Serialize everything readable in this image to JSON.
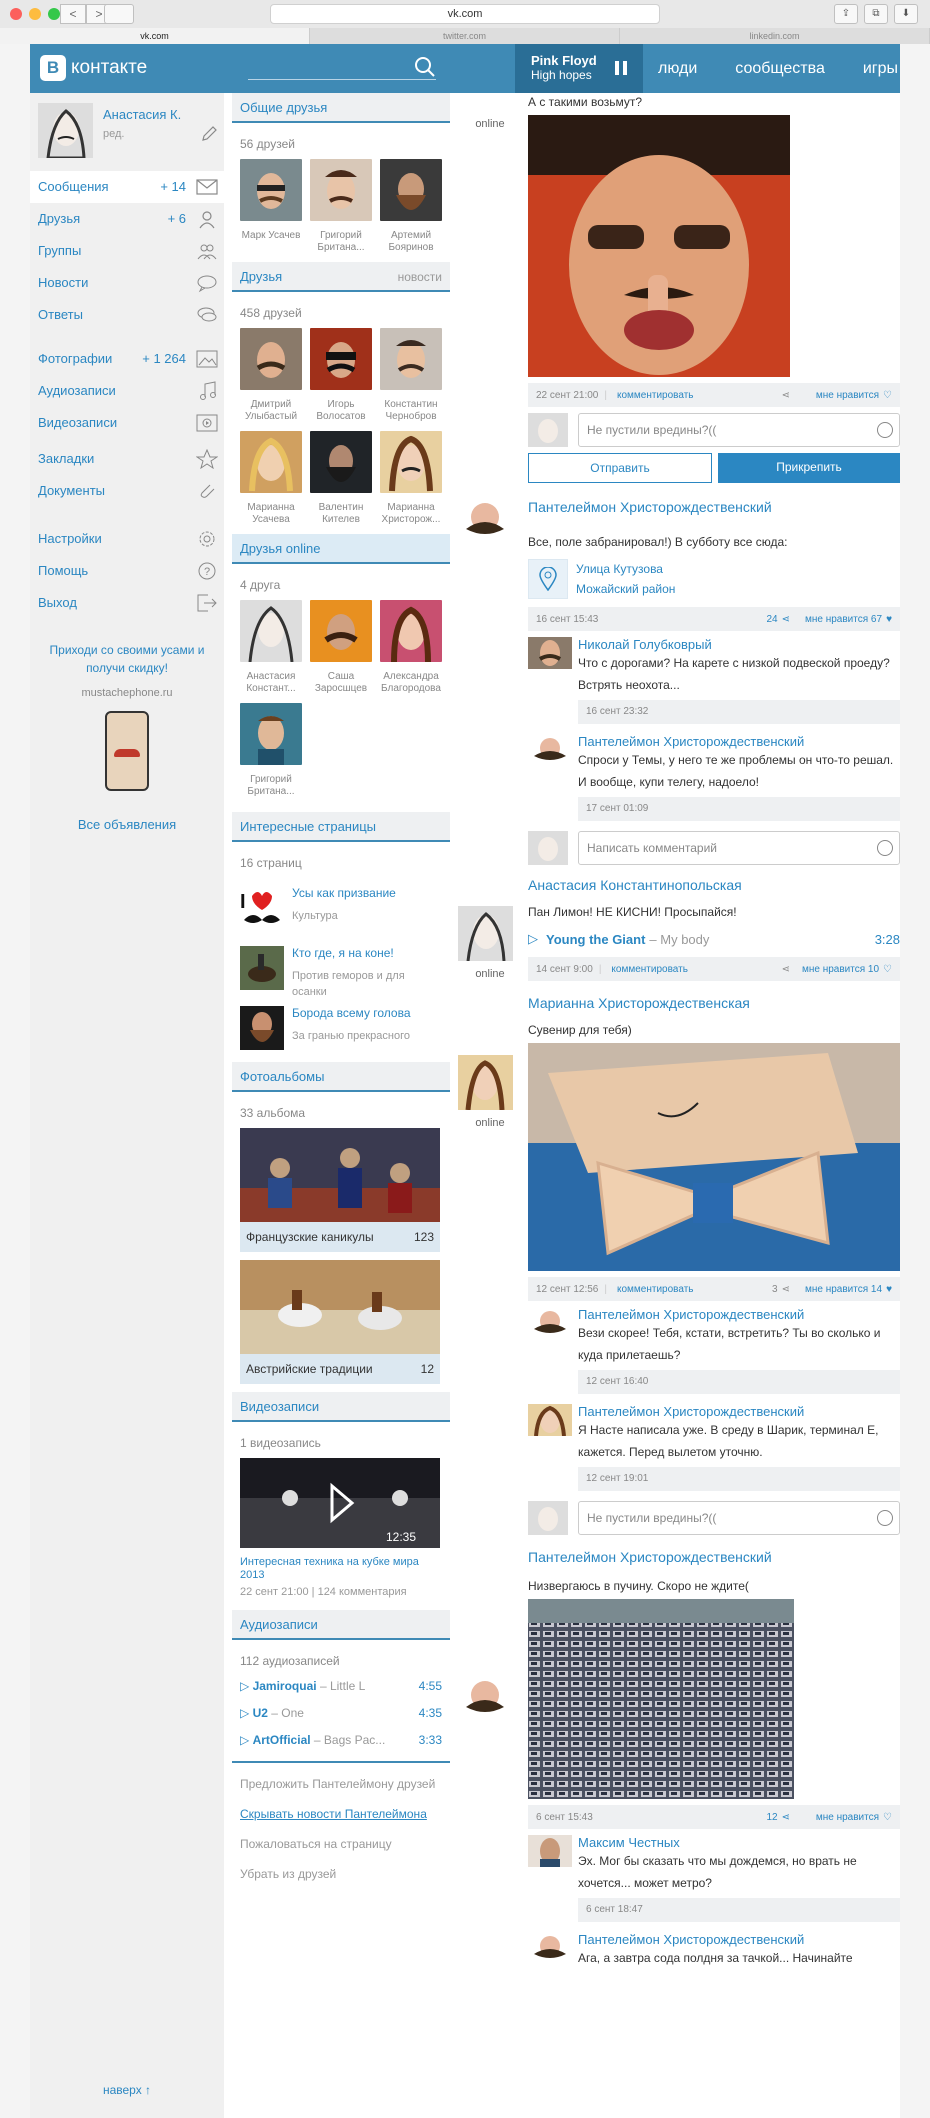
{
  "browser": {
    "url": "vk.com",
    "tabs": [
      "vk.com",
      "twitter.com",
      "linkedin.com"
    ],
    "back": "<",
    "forward": ">"
  },
  "header": {
    "logo_letter": "В",
    "logo_text": "контакте",
    "player_title": "Pink Floyd",
    "player_sub": "High hopes",
    "nav": [
      "люди",
      "сообщества",
      "игры"
    ]
  },
  "profile": {
    "name": "Анастасия К.",
    "edit": "ред."
  },
  "menu": [
    {
      "label": "Сообщения",
      "count": "+ 14",
      "icon": "envelope-icon"
    },
    {
      "label": "Друзья",
      "count": "+ 6",
      "icon": "person-icon"
    },
    {
      "label": "Группы",
      "count": "",
      "icon": "group-icon"
    },
    {
      "label": "Новости",
      "count": "",
      "icon": "speech-bubble-icon"
    },
    {
      "label": "Ответы",
      "count": "",
      "icon": "chat-bubbles-icon"
    }
  ],
  "menu2": [
    {
      "label": "Фотографии",
      "count": "+ 1 264",
      "icon": "photo-icon"
    },
    {
      "label": "Аудиозаписи",
      "count": "",
      "icon": "music-note-icon"
    },
    {
      "label": "Видеозаписи",
      "count": "",
      "icon": "video-icon"
    }
  ],
  "menu3": [
    {
      "label": "Закладки",
      "icon": "star-icon"
    },
    {
      "label": "Документы",
      "icon": "paperclip-icon"
    }
  ],
  "menu4": [
    {
      "label": "Настройки",
      "icon": "gear-icon"
    },
    {
      "label": "Помощь",
      "icon": "question-icon"
    },
    {
      "label": "Выход",
      "icon": "exit-icon"
    }
  ],
  "ad": {
    "text": "Приходи со своими усами и получи скидку!",
    "url": "mustachephone.ru",
    "all": "Все объявления"
  },
  "up": "наверх ↑",
  "common_friends": {
    "title": "Общие друзья",
    "count": "56 друзей",
    "items": [
      {
        "name": "Марк Усачев"
      },
      {
        "name": "Григорий Британа..."
      },
      {
        "name": "Артемий Бояринов"
      }
    ]
  },
  "friends": {
    "title": "Друзья",
    "right": "новости",
    "count": "458 друзей",
    "items": [
      {
        "name": "Дмитрий Улыбастый"
      },
      {
        "name": "Игорь Волосатов"
      },
      {
        "name": "Константин Чернобров"
      },
      {
        "name": "Марианна Усачева"
      },
      {
        "name": "Валентин Кителев"
      },
      {
        "name": "Марианна Христорож..."
      }
    ]
  },
  "friends_online": {
    "title": "Друзья online",
    "count": "4 друга",
    "items": [
      {
        "name": "Анастасия Констант..."
      },
      {
        "name": "Саша Заросшцев"
      },
      {
        "name": "Александра Благородова"
      },
      {
        "name": "Григорий Британа..."
      }
    ]
  },
  "pages": {
    "title": "Интересные страницы",
    "count": "16 страниц",
    "items": [
      {
        "name": "Усы как призвание",
        "sub": "Культура"
      },
      {
        "name": "Кто где, я на коне!",
        "sub": "Против геморов и для осанки"
      },
      {
        "name": "Борода всему голова",
        "sub": "За гранью прекрасного"
      }
    ]
  },
  "albums": {
    "title": "Фотоальбомы",
    "count": "33 альбома",
    "items": [
      {
        "name": "Французские каникулы",
        "n": "123"
      },
      {
        "name": "Австрийские традиции",
        "n": "12"
      }
    ]
  },
  "videos": {
    "title": "Видеозаписи",
    "count": "1 видеозапись",
    "duration": "12:35",
    "name": "Интересная техника на кубке мира 2013",
    "meta": "22 сент 21:00 | 124 комментария"
  },
  "audios": {
    "title": "Аудиозаписи",
    "count": "112 аудиозаписей",
    "items": [
      {
        "artist": "Jamiroquai",
        "song": "– Little L",
        "dur": "4:55"
      },
      {
        "artist": "U2",
        "song": "– One",
        "dur": "4:35"
      },
      {
        "artist": "ArtOfficial",
        "song": "– Bags Pac...",
        "dur": "3:33"
      }
    ]
  },
  "links": [
    "Предложить Пантелеймону друзей",
    "Скрывать новости Пантелеймона",
    "Пожаловаться на страницу",
    "Убрать из друзей"
  ],
  "online": "online",
  "posts": {
    "p1": {
      "text": "А с такими возьмут?",
      "date": "22 сент 21:00",
      "comment": "комментировать",
      "like": "мне нравится",
      "input": "Не пустили вредины?((",
      "send": "Отправить",
      "attach": "Прикрепить"
    },
    "p2": {
      "author": "Пантелеймон Христорождественский",
      "text": "Все, поле забранировал!) В субботу все сюда:",
      "place1": "Улица Кутузова",
      "place2": "Можайский район",
      "date": "16 сент 15:43",
      "shares": "24",
      "like": "мне нравится 67",
      "c1": {
        "author": "Николай Голубковрый",
        "text": "Что с дорогами? На карете  с низкой подвеской проеду? Встрять неохота...",
        "date": "16 сент 23:32"
      },
      "c2": {
        "author": "Пантелеймон Христорождественский",
        "text": "Спроси у Темы, у него те же проблемы он что-то решал. И вообще, купи телегу, надоело!",
        "date": "17 сент 01:09"
      },
      "input": "Написать комментарий"
    },
    "p3": {
      "author": "Анастасия Константинопольская",
      "text": "Пан Лимон! НЕ КИСНИ! Просыпайся!",
      "track": "Young the Giant",
      "song": "– My body",
      "dur": "3:28",
      "date": "14 сент 9:00",
      "comment": "комментировать",
      "like": "мне нравится 10"
    },
    "p4": {
      "author": "Марианна Христорождественская",
      "text": "Сувенир для тебя)",
      "date": "12 сент 12:56",
      "comment": "комментировать",
      "shares": "3",
      "like": "мне нравится 14",
      "c1": {
        "author": "Пантелеймон Христорождественский",
        "text": "Вези скорее! Тебя, кстати, встретить? Ты во сколько и куда прилетаешь?",
        "date": "12 сент 16:40"
      },
      "c2": {
        "author": "Пантелеймон Христорождественский",
        "text": "Я Насте написала уже. В среду в Шарик, терминал Е, кажется. Перед вылетом уточню.",
        "date": "12 сент 19:01"
      },
      "input": "Не пустили вредины?(("
    },
    "p5": {
      "author": "Пантелеймон Христорождественский",
      "text": "Низвергаюсь в пучину. Скоро не ждите(",
      "date": "6 сент 15:43",
      "shares": "12",
      "like": "мне нравится",
      "c1": {
        "author": "Максим Честных",
        "text": "Эх. Мог бы сказать что мы дождемся, но врать не хочется... может метро?",
        "date": "6 сент 18:47"
      },
      "c2": {
        "author": "Пантелеймон Христорождественский",
        "text": "Ага, а завтра сода полдня за тачкой... Начинайте"
      }
    }
  },
  "colors": {
    "accent": "#2b87c2",
    "header": "#3f8ab5"
  }
}
